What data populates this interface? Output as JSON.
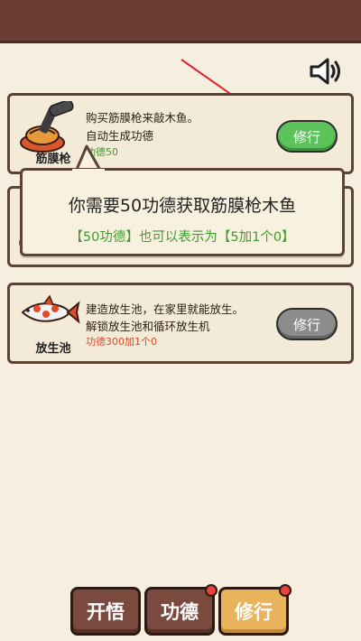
{
  "items": [
    {
      "name": "筋膜枪",
      "line1": "购买筋膜枪来敲木鱼。",
      "line2": "自动生成功德",
      "cost": "功德50",
      "button": "修行"
    },
    {
      "name": "放生池",
      "line1": "建造放生池，在家里就能放生。",
      "line2": "解锁放生池和循环放生机",
      "cost": "功德300加1个0",
      "button": "修行"
    }
  ],
  "tooltip": {
    "line1": "你需要50功德获取筋膜枪木鱼",
    "line2": "【50功德】也可以表示为【5加1个0】"
  },
  "tabs": [
    {
      "label": "开悟"
    },
    {
      "label": "功德"
    },
    {
      "label": "修行"
    }
  ],
  "colors": {
    "topbar": "#6b3d34",
    "accent_green": "#5cc25a",
    "cost_green": "#3f9b2c",
    "cost_red": "#d84a2a",
    "arrow_red": "#e0202a"
  }
}
